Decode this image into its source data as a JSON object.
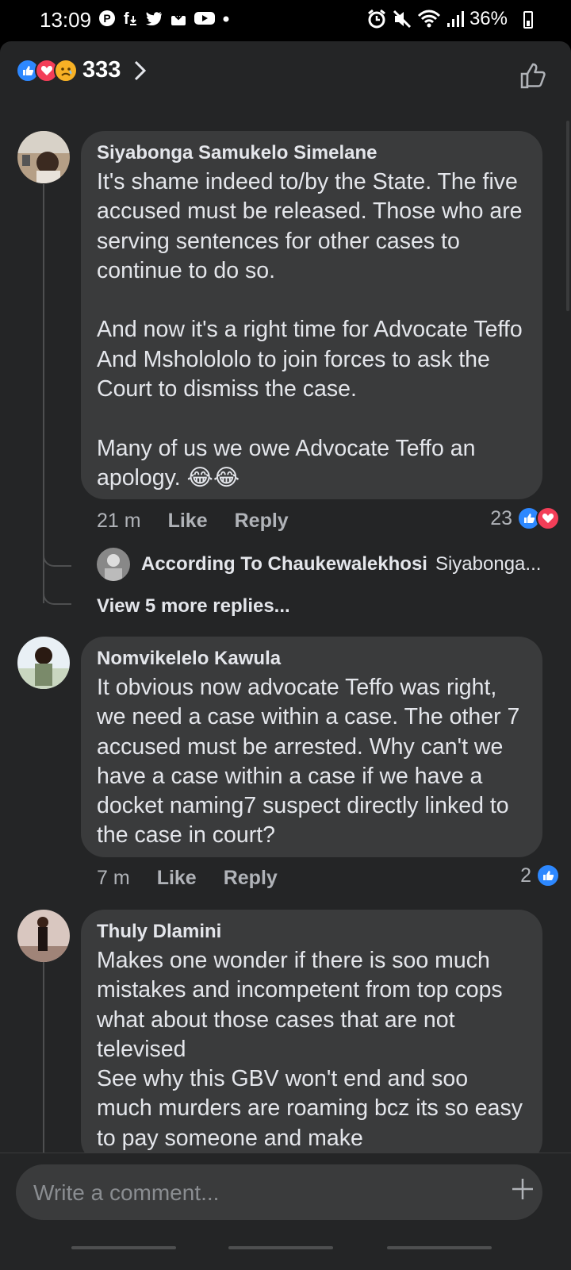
{
  "status_bar": {
    "time": "13:09",
    "battery": "36%",
    "left_icons": [
      "pinterest-icon",
      "facebook-download-icon",
      "twitter-icon",
      "download-box-icon",
      "youtube-icon",
      "dot-icon"
    ],
    "right_icons": [
      "alarm-icon",
      "mute-icon",
      "wifi-icon",
      "signal-icon",
      "battery-icon"
    ]
  },
  "reactions_header": {
    "count": "333",
    "emojis": [
      "like",
      "love",
      "sad"
    ]
  },
  "comments": [
    {
      "author": "Siyabonga Samukelo Simelane",
      "text": "It's shame indeed to/by the State. The five accused must be released. Those who are serving sentences for other cases to continue to do so.\n\nAnd now it's a right time for Advocate Teffo And Msholololo to join forces to ask the Court to dismiss the case.\n\nMany of us we owe Advocate Teffo an apology. 😂😂",
      "time": "21 m",
      "like_label": "Like",
      "reply_label": "Reply",
      "reaction_count": "23"
    },
    {
      "author": "Nomvikelelo Kawula",
      "text": "It obvious now advocate Teffo was right, we need a case within a case. The other 7 accused must be arrested. Why can't we have a case within a case if we have a docket naming7 suspect directly linked to the case in court?",
      "time": "7 m",
      "like_label": "Like",
      "reply_label": "Reply",
      "reaction_count": "2"
    },
    {
      "author": "Thuly Dlamini",
      "text": "Makes one wonder if there is soo much mistakes and incompetent from top cops what about those cases that are not televised\nSee why this GBV won't end and soo much murders are roaming bcz its so easy to pay someone and make"
    }
  ],
  "reply_preview": {
    "author": "According To Chaukewalekhosi",
    "snippet": "Siyabonga..."
  },
  "view_more_replies": "View 5 more replies...",
  "composer": {
    "placeholder": "Write a comment..."
  },
  "colors": {
    "background": "#242526",
    "bubble": "#3a3b3c",
    "text": "#e4e6eb",
    "secondary": "#b0b3b8",
    "like_blue": "#2d88ff",
    "love_red": "#f33e58",
    "haha_yellow": "#f7b125"
  }
}
